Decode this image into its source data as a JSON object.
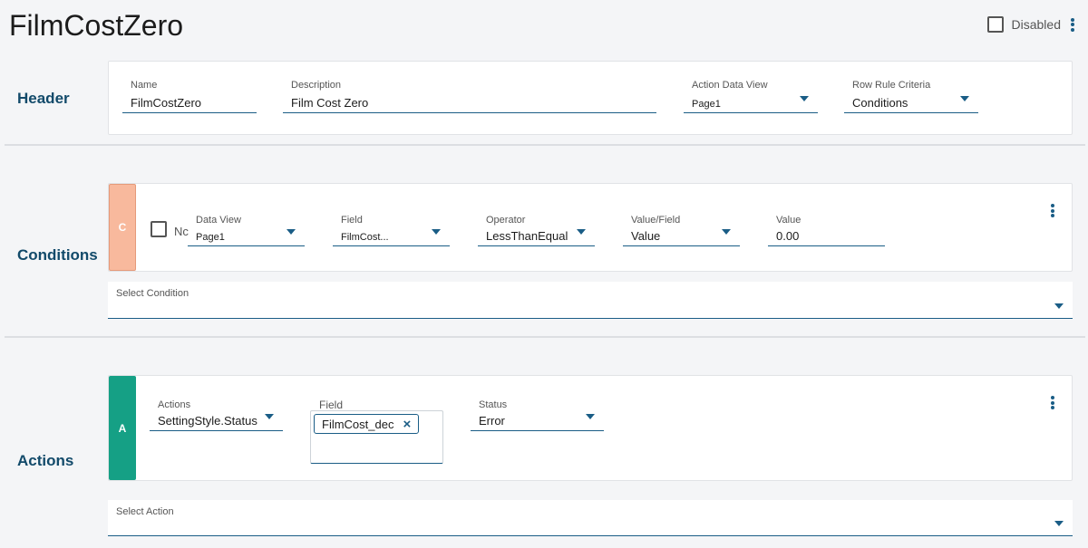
{
  "title": "FilmCostZero",
  "top": {
    "disabled_label": "Disabled",
    "menu_icon": "kebab-icon"
  },
  "header": {
    "section_label": "Header",
    "name_label": "Name",
    "name_value": "FilmCostZero",
    "description_label": "Description",
    "description_value": "Film Cost Zero",
    "action_data_view_label": "Action Data View",
    "action_data_view_value": "Page1",
    "row_rule_label": "Row Rule Criteria",
    "row_rule_value": "Conditions"
  },
  "conditions": {
    "section_label": "Conditions",
    "tag": "C",
    "not_label": "Nc",
    "data_view_label": "Data View",
    "data_view_value": "Page1",
    "field_label": "Field",
    "field_value": "FilmCost...",
    "operator_label": "Operator",
    "operator_value": "LessThanEqual",
    "value_field_label": "Value/Field",
    "value_field_value": "Value",
    "value_label": "Value",
    "value_value": "0.00",
    "select_label": "Select Condition"
  },
  "actions": {
    "section_label": "Actions",
    "tag": "A",
    "actions_label": "Actions",
    "actions_value": "SettingStyle.Status",
    "field_label": "Field",
    "field_chip": "FilmCost_dec",
    "status_label": "Status",
    "status_value": "Error",
    "select_label": "Select Action"
  },
  "colors": {
    "accent": "#1a5d86",
    "condition_tag": "#f8b99d",
    "action_tag": "#15a085"
  }
}
